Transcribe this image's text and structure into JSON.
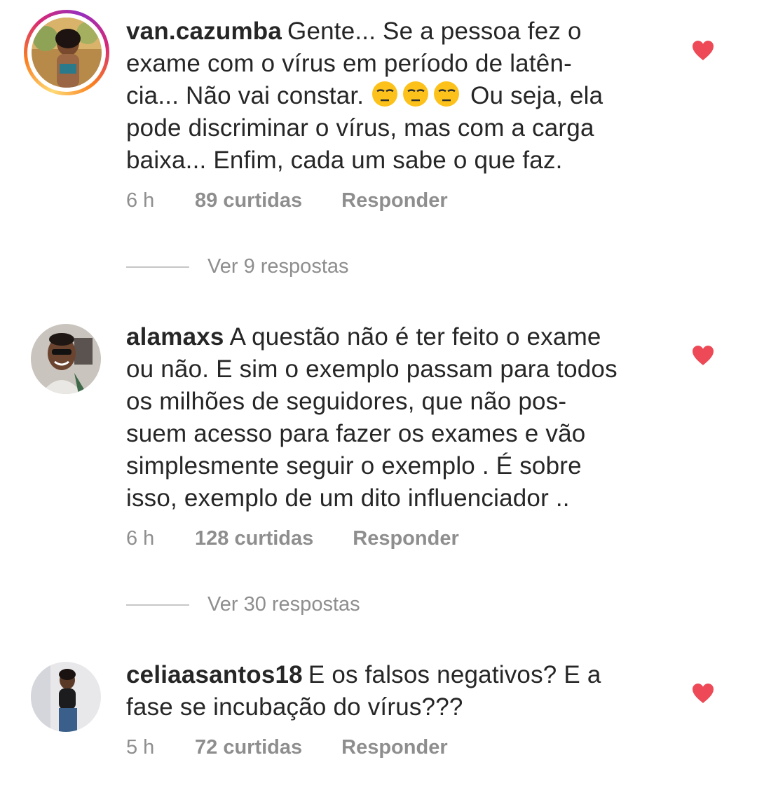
{
  "comments": [
    {
      "username": "van.cazumba",
      "lines": [
        "Gente... Se a pessoa fez o",
        "exame  com o vírus em período de latên-",
        "cia... Não vai constar.",
        "pode discriminar o vírus, mas com a carga",
        "baixa... Enfim, cada um sabe o que faz."
      ],
      "line3_suffix": "Ou seja, ela",
      "emoji": "unamused-face-icon",
      "time": "6 h",
      "likes": "89 curtidas",
      "reply": "Responder",
      "view_replies": "Ver 9 respostas"
    },
    {
      "username": "alamaxs",
      "lines": [
        "A questão não é ter feito o exame",
        "ou não. E sim o exemplo passam para todos",
        "os milhões de seguidores, que não pos-",
        "suem acesso para fazer os exames e vão",
        "simplesmente seguir o exemplo .  É sobre",
        "isso, exemplo de um dito influenciador .."
      ],
      "time": "6 h",
      "likes": "128 curtidas",
      "reply": "Responder",
      "view_replies": "Ver 30 respostas"
    },
    {
      "username": "celiaasantos18",
      "lines": [
        "E os falsos negativos? E a",
        "fase se incubação do vírus???"
      ],
      "time": "5 h",
      "likes": "72 curtidas",
      "reply": "Responder"
    }
  ],
  "colors": {
    "heart": "#ed4956",
    "secondary_text": "#8e8e8e",
    "primary_text": "#262626"
  }
}
